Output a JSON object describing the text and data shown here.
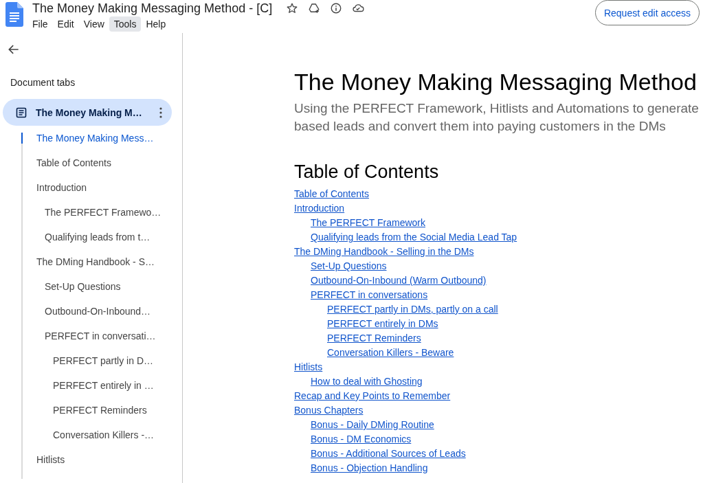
{
  "header": {
    "title": "The Money Making Messaging Method - [C]",
    "menu": [
      {
        "label": "File",
        "selected": false
      },
      {
        "label": "Edit",
        "selected": false
      },
      {
        "label": "View",
        "selected": false
      },
      {
        "label": "Tools",
        "selected": true
      },
      {
        "label": "Help",
        "selected": false
      }
    ],
    "share_button": "Request edit access"
  },
  "sidebar": {
    "heading": "Document tabs",
    "tab": {
      "label": "The Money Making M…",
      "selected": true
    },
    "outline": [
      {
        "label": "The Money Making Mess…",
        "selected": true
      },
      {
        "label": "Table of Contents",
        "selected": false
      },
      {
        "label": "Introduction",
        "selected": false,
        "children": [
          {
            "label": "The PERFECT Framewo…",
            "selected": false
          },
          {
            "label": "Qualifying leads from t…",
            "selected": false
          }
        ]
      },
      {
        "label": "The DMing Handbook - S…",
        "selected": false,
        "children": [
          {
            "label": "Set-Up Questions",
            "selected": false
          },
          {
            "label": "Outbound-On-Inbound…",
            "selected": false
          },
          {
            "label": "PERFECT in conversati…",
            "selected": false,
            "children": [
              {
                "label": "PERFECT partly in D…",
                "selected": false
              },
              {
                "label": "PERFECT entirely in …",
                "selected": false
              },
              {
                "label": "PERFECT Reminders",
                "selected": false
              },
              {
                "label": "Conversation Killers -…",
                "selected": false
              }
            ]
          }
        ]
      },
      {
        "label": "Hitlists",
        "selected": false
      }
    ]
  },
  "document": {
    "title": "The Money Making Messaging Method",
    "subtitle": "Using the PERFECT Framework, Hitlists and Automations to generate based leads and convert them into paying customers in the DMs",
    "toc_heading": "Table of Contents",
    "toc": [
      {
        "label": "Table of Contents"
      },
      {
        "label": "Introduction",
        "children": [
          {
            "label": "The PERFECT Framework"
          },
          {
            "label": "Qualifying leads from the Social Media Lead Tap"
          }
        ]
      },
      {
        "label": "The DMing Handbook - Selling in the DMs",
        "children": [
          {
            "label": "Set-Up Questions"
          },
          {
            "label": "Outbound-On-Inbound (Warm Outbound)"
          },
          {
            "label": "PERFECT in conversations",
            "children": [
              {
                "label": "PERFECT partly in DMs, partly on a call"
              },
              {
                "label": "PERFECT entirely in DMs"
              },
              {
                "label": "PERFECT Reminders"
              },
              {
                "label": "Conversation Killers - Beware"
              }
            ]
          }
        ]
      },
      {
        "label": "Hitlists",
        "children": [
          {
            "label": "How to deal with Ghosting"
          }
        ]
      },
      {
        "label": "Recap and Key Points to Remember"
      },
      {
        "label": "Bonus Chapters",
        "children": [
          {
            "label": "Bonus - Daily DMing Routine"
          },
          {
            "label": "Bonus - DM Economics"
          },
          {
            "label": "Bonus - Additional Sources of Leads"
          },
          {
            "label": "Bonus - Objection Handling"
          }
        ]
      }
    ]
  }
}
